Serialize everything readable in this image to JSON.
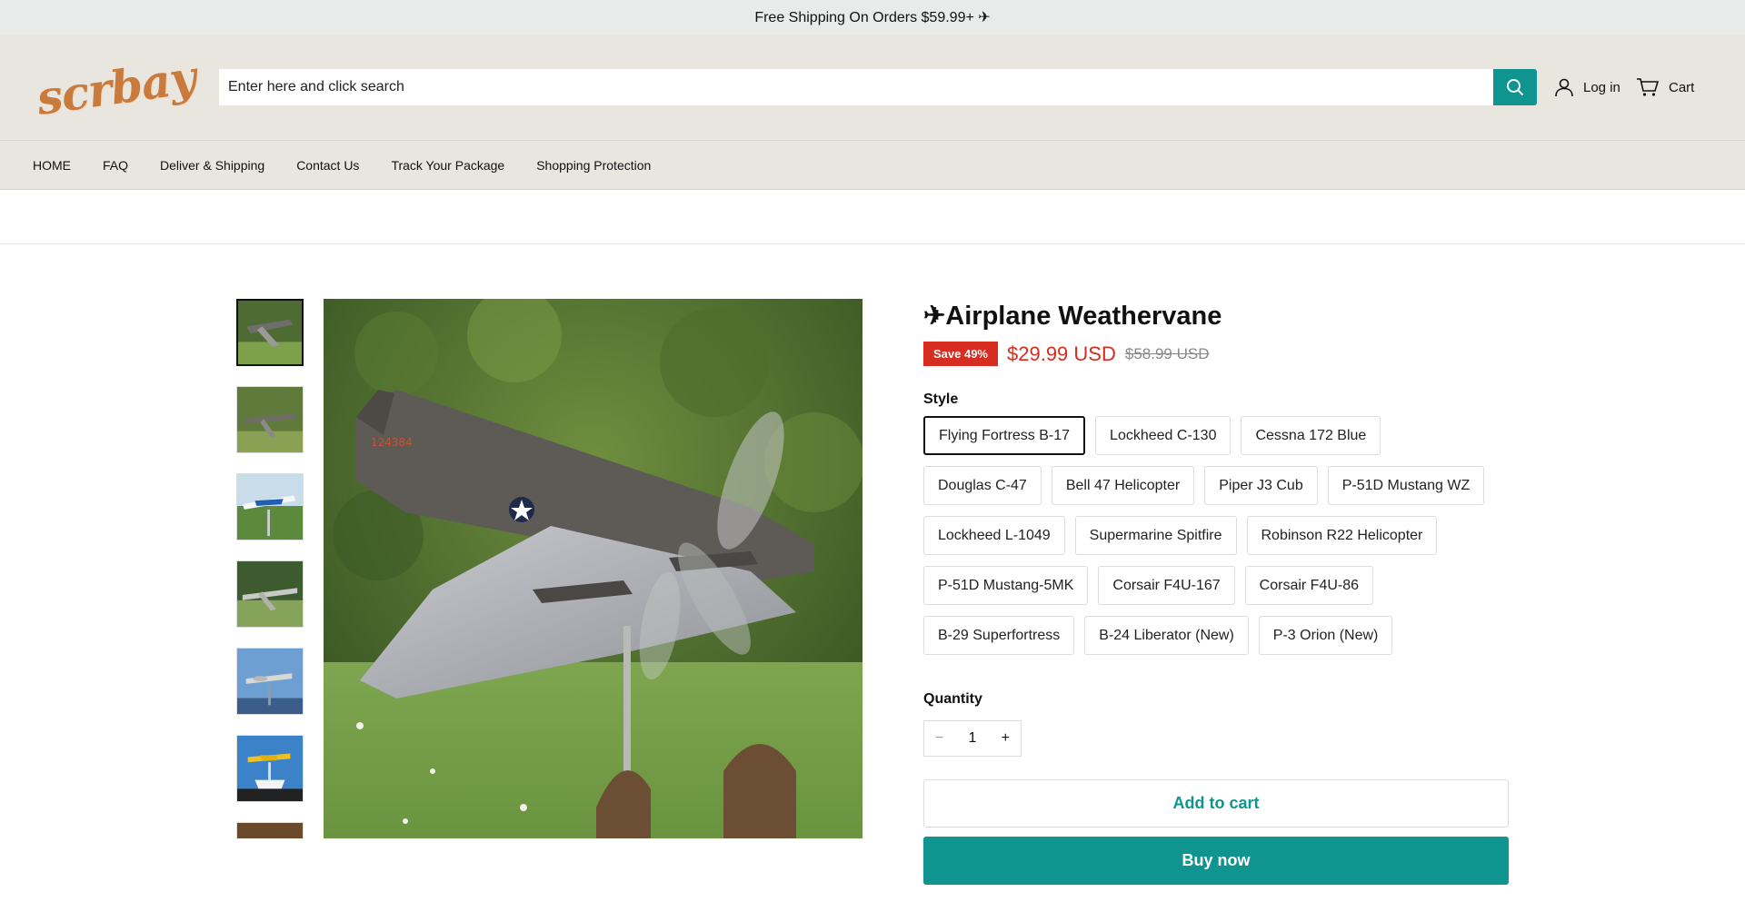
{
  "announcement": {
    "text": "Free Shipping On Orders $59.99+ ✈"
  },
  "header": {
    "logo_text": "scrbay",
    "search_placeholder": "Enter here and click search",
    "login_label": "Log in",
    "cart_label": "Cart",
    "accent_color": "#0f9490"
  },
  "nav": {
    "items": [
      {
        "label": "HOME"
      },
      {
        "label": "FAQ"
      },
      {
        "label": "Deliver & Shipping"
      },
      {
        "label": "Contact Us"
      },
      {
        "label": "Track Your Package"
      },
      {
        "label": "Shopping Protection"
      }
    ]
  },
  "product": {
    "title": "✈Airplane Weathervane",
    "save_badge": "Save 49%",
    "price": "$29.99 USD",
    "compare_price": "$58.99 USD",
    "style_label": "Style",
    "selected_style": "Flying Fortress B-17",
    "styles": [
      "Flying Fortress B-17",
      "Lockheed C-130",
      "Cessna 172 Blue",
      "Douglas C-47",
      "Bell 47 Helicopter",
      "Piper J3 Cub",
      "P-51D Mustang WZ",
      "Lockheed L-1049",
      "Supermarine Spitfire",
      "Robinson R22 Helicopter",
      "P-51D Mustang-5MK",
      "Corsair F4U-167",
      "Corsair F4U-86",
      "B-29 Superfortress",
      "B-24 Liberator (New)",
      "P-3 Orion (New)"
    ],
    "quantity_label": "Quantity",
    "quantity_value": "1",
    "minus_symbol": "−",
    "plus_symbol": "+",
    "add_to_cart_label": "Add to cart",
    "buy_now_label": "Buy now",
    "sale_color": "#d62d20"
  }
}
